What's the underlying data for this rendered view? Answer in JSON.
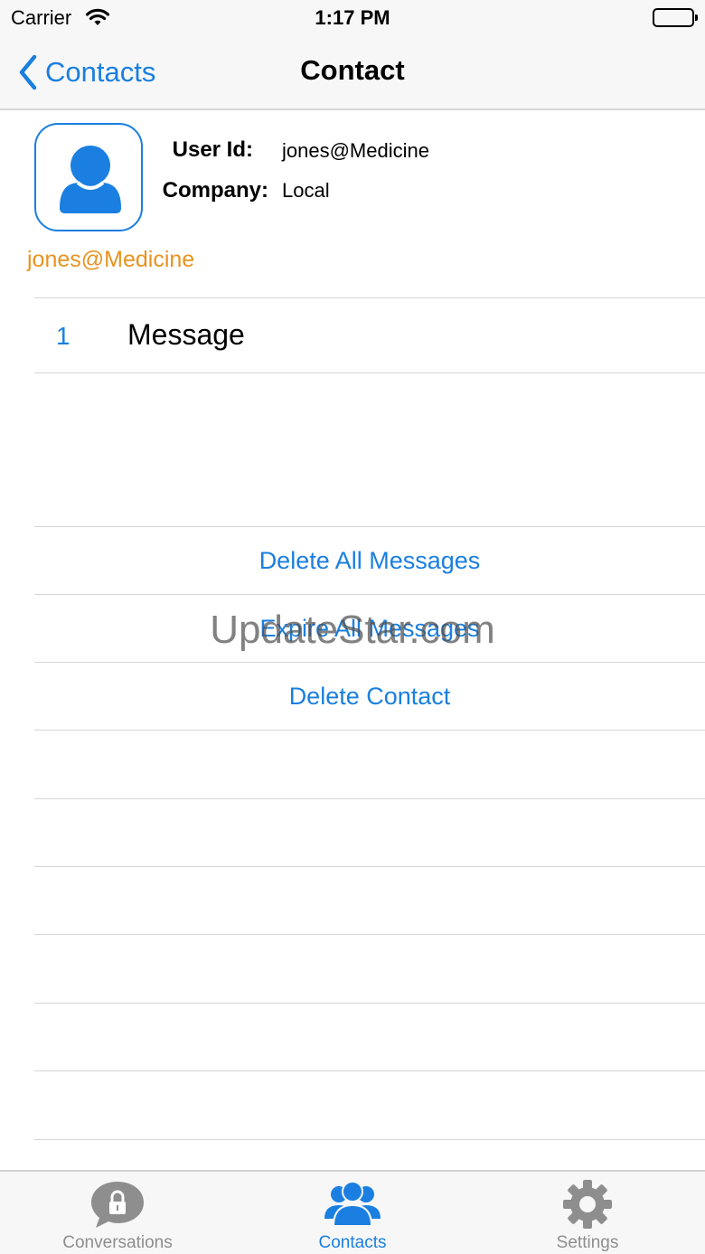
{
  "status_bar": {
    "carrier": "Carrier",
    "time": "1:17 PM"
  },
  "nav": {
    "back_label": "Contacts",
    "title": "Contact"
  },
  "contact": {
    "user_id_label": "User Id:",
    "user_id": "jones@Medicine",
    "company_label": "Company:",
    "company": "Local",
    "name": "jones@Medicine"
  },
  "messages": {
    "count": "1",
    "label": "Message"
  },
  "actions": {
    "delete_all": "Delete All Messages",
    "expire_all": "Expire All Messages",
    "delete_contact": "Delete Contact"
  },
  "watermark": "UpdateStar.com",
  "tabs": [
    {
      "label": "Conversations",
      "icon": "lock-bubble-icon",
      "active": false
    },
    {
      "label": "Contacts",
      "icon": "people-icon",
      "active": true
    },
    {
      "label": "Settings",
      "icon": "gear-icon",
      "active": false
    }
  ],
  "colors": {
    "accent": "#1a7fe0",
    "name_orange": "#e89320",
    "inactive_tab": "#8e8e8e"
  }
}
